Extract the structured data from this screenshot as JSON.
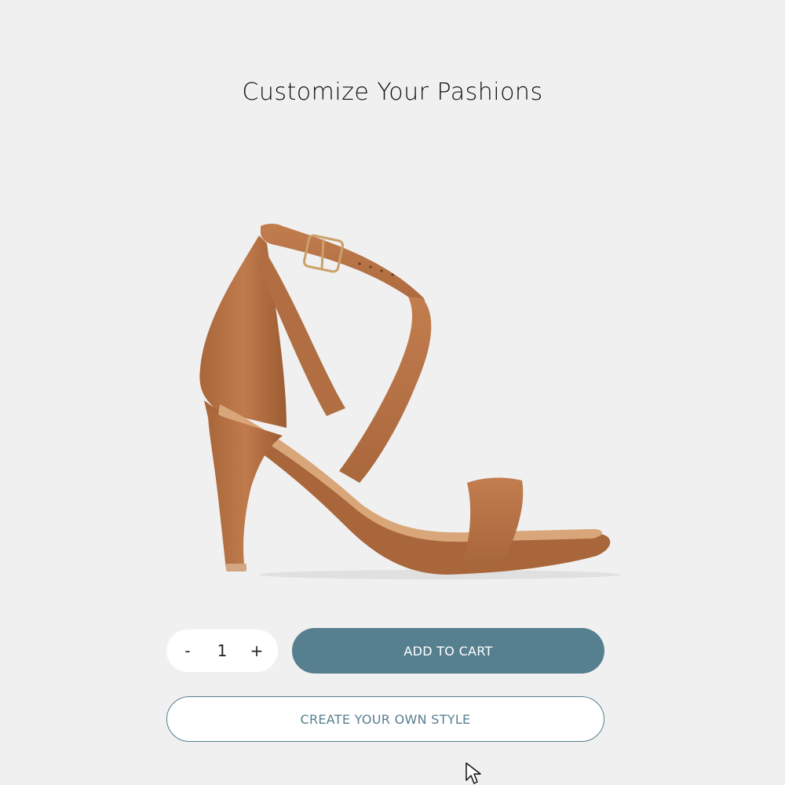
{
  "page": {
    "title": "Customize Your Pashions"
  },
  "product": {
    "image_icon": "strappy-high-heel-sandal-image",
    "color": "#b87548"
  },
  "quantity": {
    "decrement_label": "-",
    "value": "1",
    "increment_label": "+"
  },
  "actions": {
    "add_to_cart_label": "ADD TO CART",
    "create_style_label": "CREATE YOUR OWN STYLE"
  },
  "colors": {
    "accent": "#567f8f",
    "background": "#f0f0f0"
  }
}
